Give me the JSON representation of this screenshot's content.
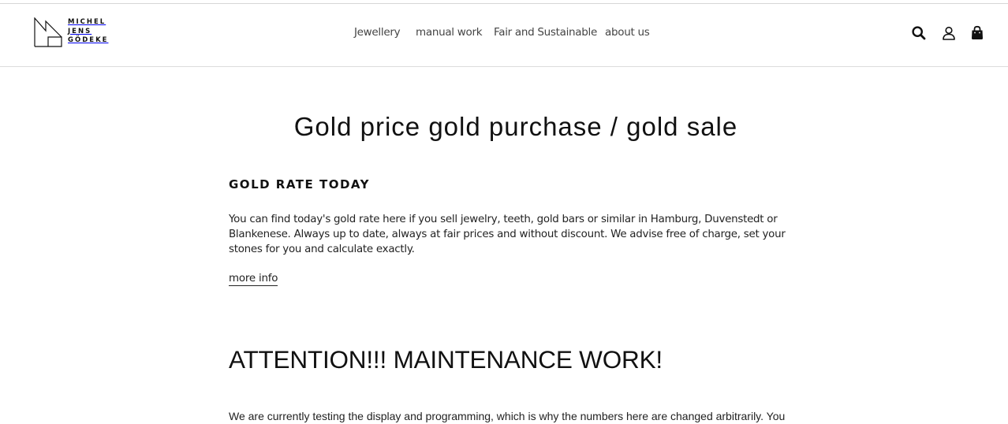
{
  "header": {
    "logo": {
      "line1": "MICHEL",
      "line2": "JENS",
      "line3": "GÖDEKE"
    },
    "nav": [
      {
        "label": "Jewellery"
      },
      {
        "label": "manual work"
      },
      {
        "label": "Fair and Sustainable"
      },
      {
        "label": "about us"
      }
    ],
    "icons": [
      "search-icon",
      "account-icon",
      "shopping-bag-icon"
    ]
  },
  "main": {
    "title": "Gold price gold purchase / gold sale",
    "section_heading": "GOLD RATE TODAY",
    "intro": "You can find today's gold rate here if you sell jewelry, teeth, gold bars or similar in Hamburg, Duvenstedt or Blankenese. Always up to date, always at fair prices and without discount. We advise free of charge, set your stones for you and calculate exactly.",
    "more_link": "more info",
    "attention_heading": "ATTENTION!!! MAINTENANCE WORK!",
    "notice": "We are currently testing the display and programming, which is why the numbers here are changed arbitrarily. You"
  },
  "colors": {
    "text": "#111111",
    "nav_text": "#444444",
    "divider": "#dcdcdc",
    "background": "#ffffff"
  }
}
